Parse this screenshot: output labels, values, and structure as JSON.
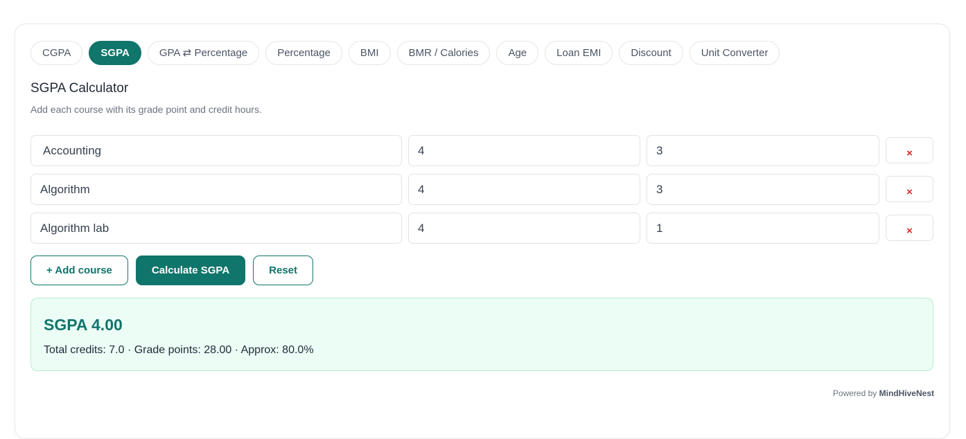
{
  "tabs": [
    {
      "label": "CGPA",
      "active": false
    },
    {
      "label": "SGPA",
      "active": true
    },
    {
      "label": "GPA ⇄ Percentage",
      "active": false
    },
    {
      "label": "Percentage",
      "active": false
    },
    {
      "label": "BMI",
      "active": false
    },
    {
      "label": "BMR / Calories",
      "active": false
    },
    {
      "label": "Age",
      "active": false
    },
    {
      "label": "Loan EMI",
      "active": false
    },
    {
      "label": "Discount",
      "active": false
    },
    {
      "label": "Unit Converter",
      "active": false
    }
  ],
  "calculator": {
    "title": "SGPA Calculator",
    "subtitle": "Add each course with its grade point and credit hours."
  },
  "courses": [
    {
      "name": "Accounting",
      "grade": "4",
      "credits": "3",
      "delete_label": "×"
    },
    {
      "name": "Algorithm",
      "grade": "4",
      "credits": "3",
      "delete_label": "×"
    },
    {
      "name": "Algorithm lab",
      "grade": "4",
      "credits": "1",
      "delete_label": "×"
    }
  ],
  "actions": {
    "add_label": "+ Add course",
    "calculate_label": "Calculate SGPA",
    "reset_label": "Reset"
  },
  "result": {
    "title": "SGPA 4.00",
    "detail": "Total credits: 7.0 · Grade points: 28.00 · Approx: 80.0%"
  },
  "footer": {
    "prefix": "Powered by",
    "brand": "MindHiveNest"
  },
  "colors": {
    "accent": "#10756b",
    "result_bg": "#ecfdf5",
    "delete": "#dc2626"
  }
}
